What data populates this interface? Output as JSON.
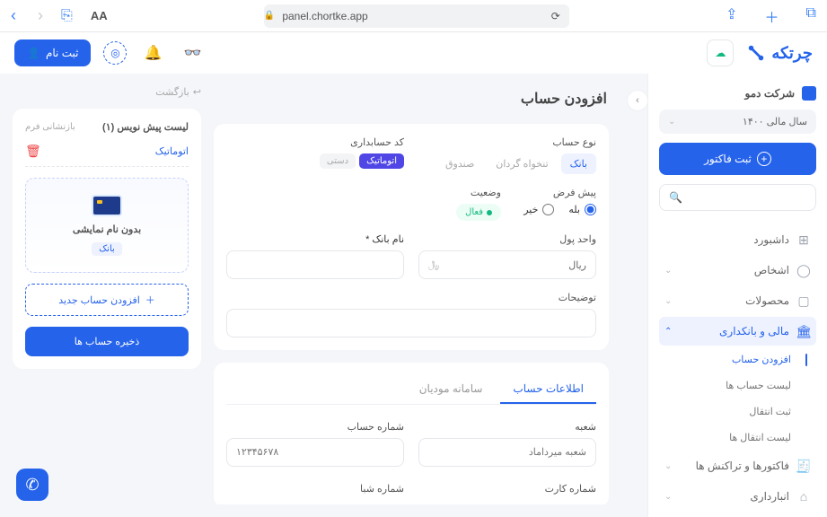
{
  "browser": {
    "url": "panel.chortke.app",
    "aa": "AA"
  },
  "appbar": {
    "brand": "چرتکه",
    "signup": "ثبت نام"
  },
  "sidebar": {
    "company": "شرکت دمو",
    "fiscal": "سال مالی ۱۴۰۰",
    "invoice_btn": "ثبت فاکتور",
    "items": [
      {
        "label": "داشبورد",
        "icon": "⊞"
      },
      {
        "label": "اشخاص",
        "icon": "👤"
      },
      {
        "label": "محصولات",
        "icon": "📦"
      },
      {
        "label": "مالی و بانکداری",
        "icon": "🏛"
      },
      {
        "label": "فاکتورها و تراکنش ها",
        "icon": "🧾"
      },
      {
        "label": "انبارداری",
        "icon": "⌂"
      }
    ],
    "finance_sub": [
      {
        "label": "افزودن حساب"
      },
      {
        "label": "لیست حساب ها"
      },
      {
        "label": "ثبت انتقال"
      },
      {
        "label": "لیست انتقال ها"
      }
    ]
  },
  "page": {
    "title": "افزودن حساب",
    "back": "بازگشت"
  },
  "form": {
    "type_label": "نوع حساب",
    "types": [
      "بانک",
      "تنخواه گردان",
      "صندوق"
    ],
    "code_label": "کد حسابداری",
    "code_modes": [
      "اتوماتیک",
      "دستی"
    ],
    "status_label": "وضعیت",
    "status_value": "فعال",
    "default_label": "پیش فرض",
    "yes": "بله",
    "no": "خیر",
    "bank_name_label": "نام بانک *",
    "currency_label": "واحد پول",
    "currency_value": "ریال",
    "currency_symbol": "﷼",
    "desc_label": "توضیحات",
    "info_tabs": [
      "اطلاعات حساب",
      "سامانه مودیان"
    ],
    "branch_label": "شعبه",
    "branch_placeholder": "شعبه میرداماد",
    "account_no_label": "شماره حساب",
    "account_no_placeholder": "۱۲۳۴۵۶۷۸",
    "card_no_label": "شماره کارت",
    "sheba_label": "شماره شبا"
  },
  "draft": {
    "title": "لیست پیش نویس (۱)",
    "reset": "بازنشانی فرم",
    "auto": "اتوماتیک",
    "no_name": "بدون نام نمایشی",
    "badge": "بانک",
    "add_new": "افزودن حساب جدید",
    "save": "ذخیره حساب ها"
  }
}
